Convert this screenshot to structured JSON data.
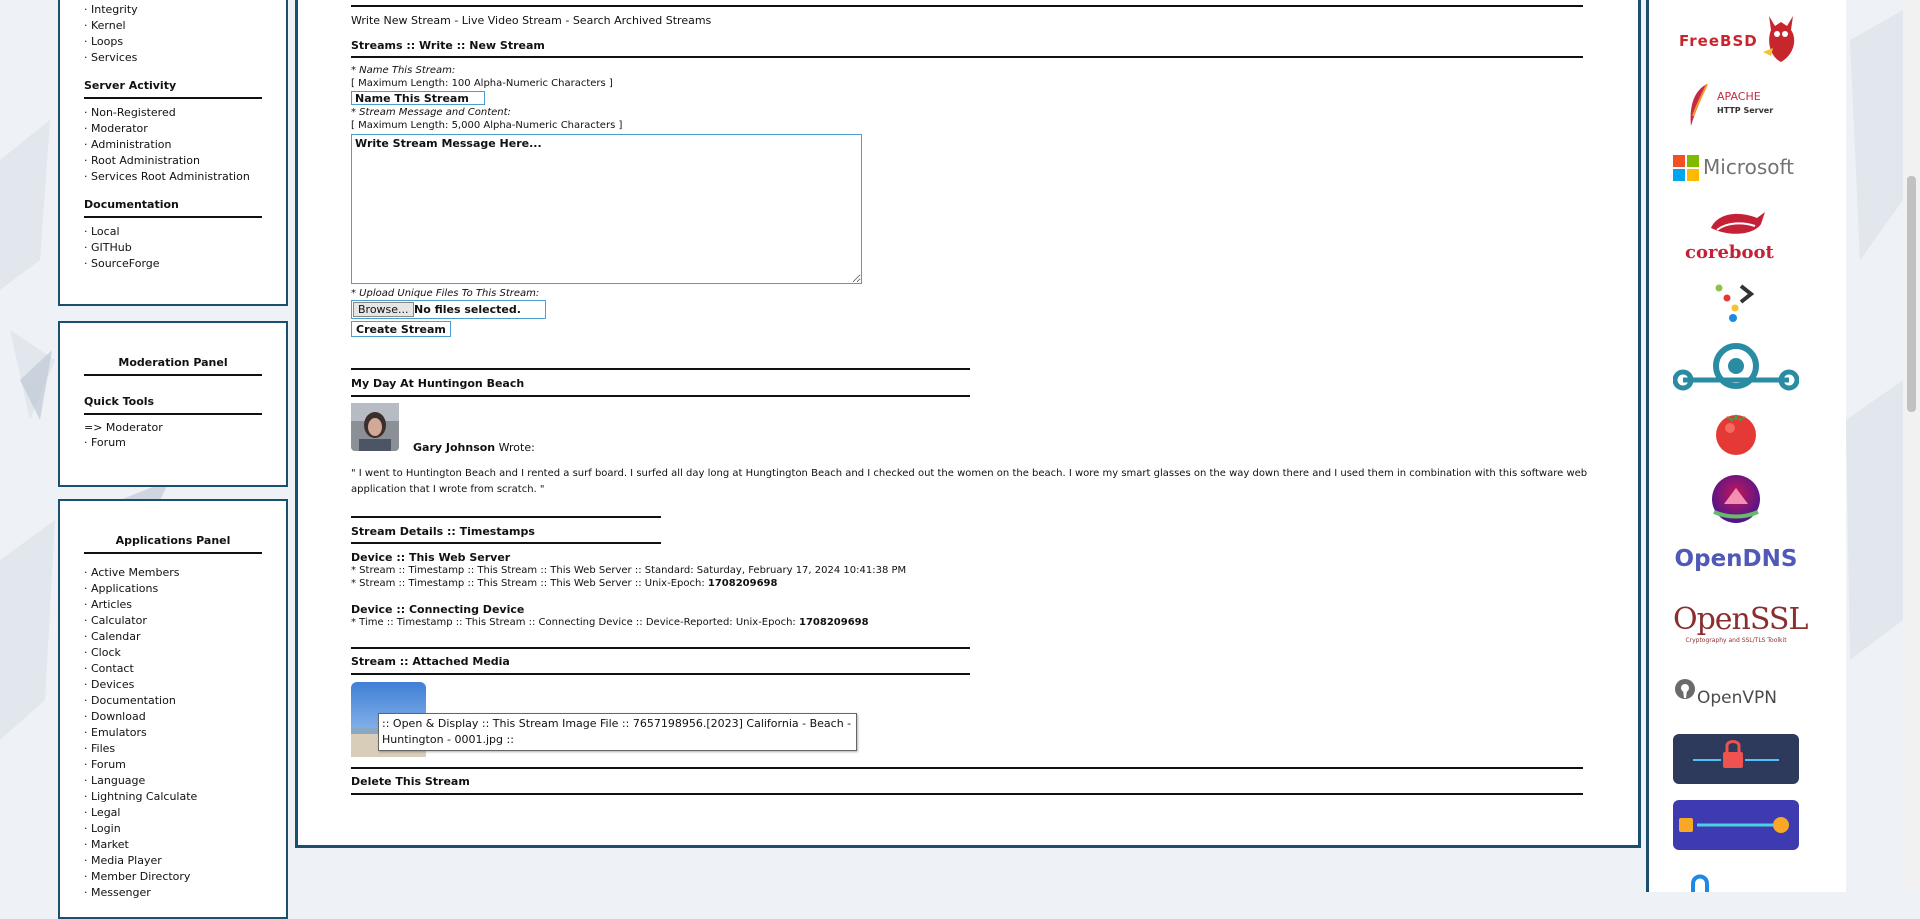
{
  "sidebar": {
    "top_items": [
      "Integrity",
      "Kernel",
      "Loops",
      "Services"
    ],
    "server_activity": {
      "title": "Server Activity",
      "items": [
        "Non-Registered",
        "Moderator",
        "Administration",
        "Root Administration",
        "Services Root Administration"
      ]
    },
    "documentation": {
      "title": "Documentation",
      "items": [
        "Local",
        "GITHub",
        "SourceForge"
      ]
    },
    "moderation_panel": {
      "title": "Moderation Panel",
      "quick_tools_title": "Quick Tools",
      "moderator_link": "=> Moderator",
      "forum_link": "Forum"
    },
    "applications_panel": {
      "title": "Applications Panel",
      "items": [
        "Active Members",
        "Applications",
        "Articles",
        "Calculator",
        "Calendar",
        "Clock",
        "Contact",
        "Devices",
        "Documentation",
        "Download",
        "Emulators",
        "Files",
        "Forum",
        "Language",
        "Lightning Calculate",
        "Legal",
        "Login",
        "Market",
        "Media Player",
        "Member Directory",
        "Messenger"
      ]
    }
  },
  "main": {
    "nav_links": "Write New Stream - Live Video Stream - Search Archived Streams",
    "breadcrumb": "Streams :: Write :: New Stream",
    "name_label": "* Name This Stream:",
    "name_limit": "[ Maximum Length: 100 Alpha-Numeric Characters ]",
    "name_value": "Name This Stream",
    "message_label": "* Stream Message and Content:",
    "message_limit": "[ Maximum Length: 5,000 Alpha-Numeric Characters ]",
    "message_value": "Write Stream Message Here...",
    "upload_label": "* Upload Unique Files To This Stream:",
    "browse_label": "Browse...",
    "files_status": "No files selected.",
    "create_label": "Create Stream",
    "post": {
      "title": "My Day At Huntingon Beach",
      "author": "Gary Johnson",
      "wrote": "Wrote:",
      "body_line1": "\" I went to Huntington Beach and I rented a surf board. I surfed all day long at Hungtington Beach and I checked out the women on the beach. I wore my smart glasses on the way down there and I used them in combination with this software web",
      "body_line2": "application that I wrote from scratch. \""
    },
    "details": {
      "title": "Stream Details :: Timestamps",
      "device_title": "Device :: This Web Server",
      "standard": "* Stream :: Timestamp :: This Stream :: This Web Server :: Standard: Saturday, February 17, 2024 10:41:38 PM",
      "unix_label": "* Stream :: Timestamp :: This Stream :: This Web Server :: Unix-Epoch:",
      "unix_value": "1708209698",
      "connecting_title": "Device :: Connecting Device",
      "connecting_label": "* Time :: Timestamp :: This Stream :: Connecting Device :: Device-Reported: Unix-Epoch:",
      "connecting_value": "1708209698"
    },
    "media": {
      "title": "Stream :: Attached Media",
      "tooltip": ":: Open & Display :: This Stream Image File :: 7657198956.[2023] California - Beach - Huntington - 0001.jpg ::"
    },
    "delete_label": "Delete This Stream"
  },
  "logos": {
    "freebsd": "FreeBSD",
    "apache_top": "APACHE",
    "apache_bottom": "HTTP Server",
    "microsoft": "Microsoft",
    "coreboot": "coreboot",
    "opendns": "OpenDNS",
    "openssl": "OpenSSL",
    "openssl_sub": "Cryptography and SSL/TLS Toolkit",
    "openvpn": "OpenVPN"
  },
  "colors": {
    "panel_border": "#1b4f6e",
    "input_border": "#4a9fd0",
    "freebsd_red": "#c8262d",
    "microsoft_grey": "#737373",
    "opendns_blue": "#5059b5"
  }
}
